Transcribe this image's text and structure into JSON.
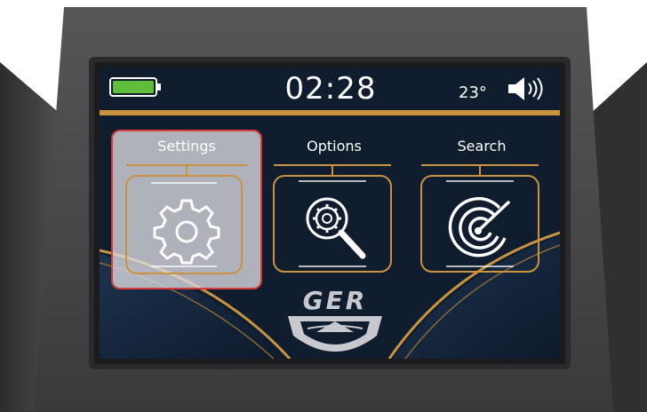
{
  "status_bar": {
    "battery_level": 1.0,
    "clock": "02:28",
    "temperature": "23°",
    "volume_icon": "speaker-volume-icon"
  },
  "menu": {
    "items": [
      {
        "label": "Settings",
        "icon": "gear-icon",
        "selected": true
      },
      {
        "label": "Options",
        "icon": "magnifier-gear-icon",
        "selected": false
      },
      {
        "label": "Search",
        "icon": "radar-icon",
        "selected": false
      }
    ]
  },
  "brand": {
    "logo_text": "GER"
  },
  "colors": {
    "screen_background": "#0f1d2e",
    "accent_gold": "#c9933f",
    "battery_green": "#5fbf3a",
    "selection_border": "#d63a3a",
    "housing": "#4a4a4c"
  }
}
